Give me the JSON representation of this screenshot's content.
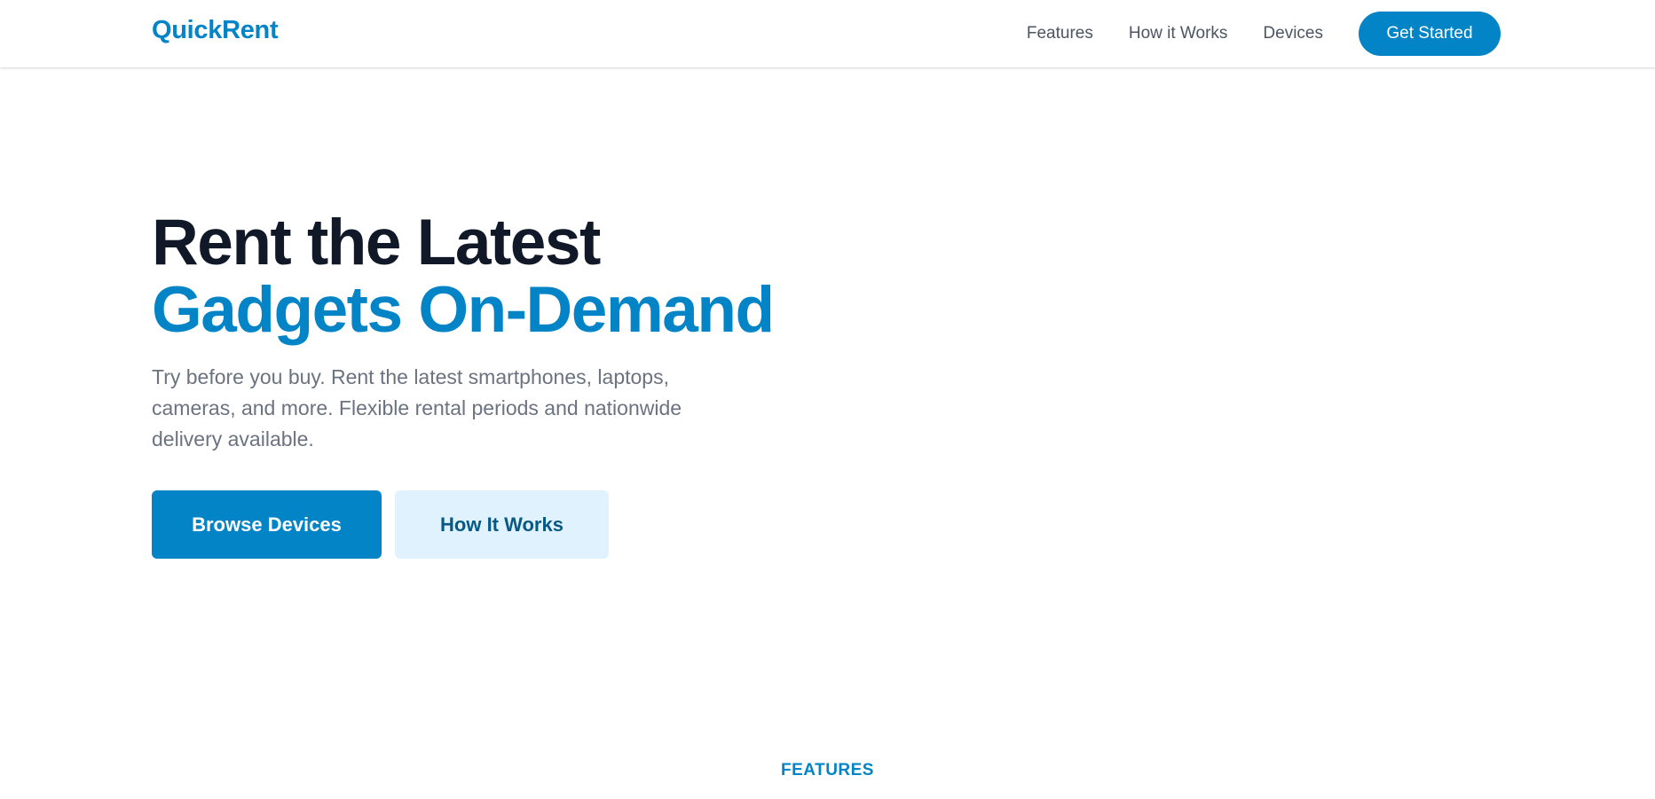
{
  "brand": {
    "name": "QuickRent",
    "accent_color": "#0284c7"
  },
  "nav": {
    "links": [
      {
        "label": "Features"
      },
      {
        "label": "How it Works"
      },
      {
        "label": "Devices"
      }
    ],
    "cta_label": "Get Started"
  },
  "hero": {
    "title_line1": "Rent the Latest",
    "title_line2": "Gadgets On-Demand",
    "description": "Try before you buy. Rent the latest smartphones, laptops, cameras, and more. Flexible rental periods and nationwide delivery available.",
    "primary_button": "Browse Devices",
    "secondary_button": "How It Works"
  },
  "features_section": {
    "eyebrow": "FEATURES"
  }
}
